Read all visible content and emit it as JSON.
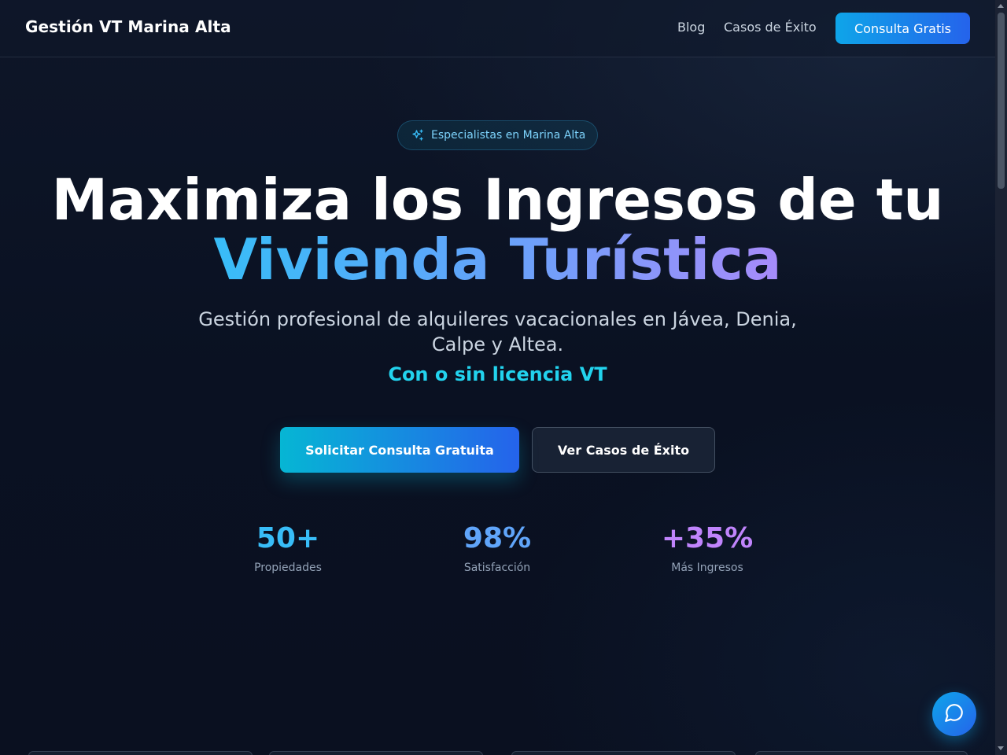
{
  "header": {
    "brand": "Gestión VT Marina Alta",
    "nav": {
      "blog": "Blog",
      "casos": "Casos de Éxito",
      "cta": "Consulta Gratis"
    }
  },
  "hero": {
    "badge": {
      "icon": "sparkles-icon",
      "text": "Especialistas en Marina Alta"
    },
    "title_line1": "Maximiza los Ingresos de tu",
    "title_line2": "Vivienda Turística",
    "subtitle": "Gestión profesional de alquileres vacacionales en Jávea, Denia, Calpe y Altea.",
    "highlight": "Con o sin licencia VT",
    "primary_button": "Solicitar Consulta Gratuita",
    "secondary_button": "Ver Casos de Éxito"
  },
  "stats": [
    {
      "value": "50+",
      "label": "Propiedades",
      "color": "#38bdf8"
    },
    {
      "value": "98%",
      "label": "Satisfacción",
      "color": "#60a5fa"
    },
    {
      "value": "+35%",
      "label": "Más Ingresos",
      "color": "#c084fc"
    }
  ],
  "chat": {
    "icon": "chat-bubble-icon"
  },
  "colors": {
    "background": "#0b1224",
    "accent_cyan": "#22d3ee",
    "accent_blue": "#2563eb"
  }
}
